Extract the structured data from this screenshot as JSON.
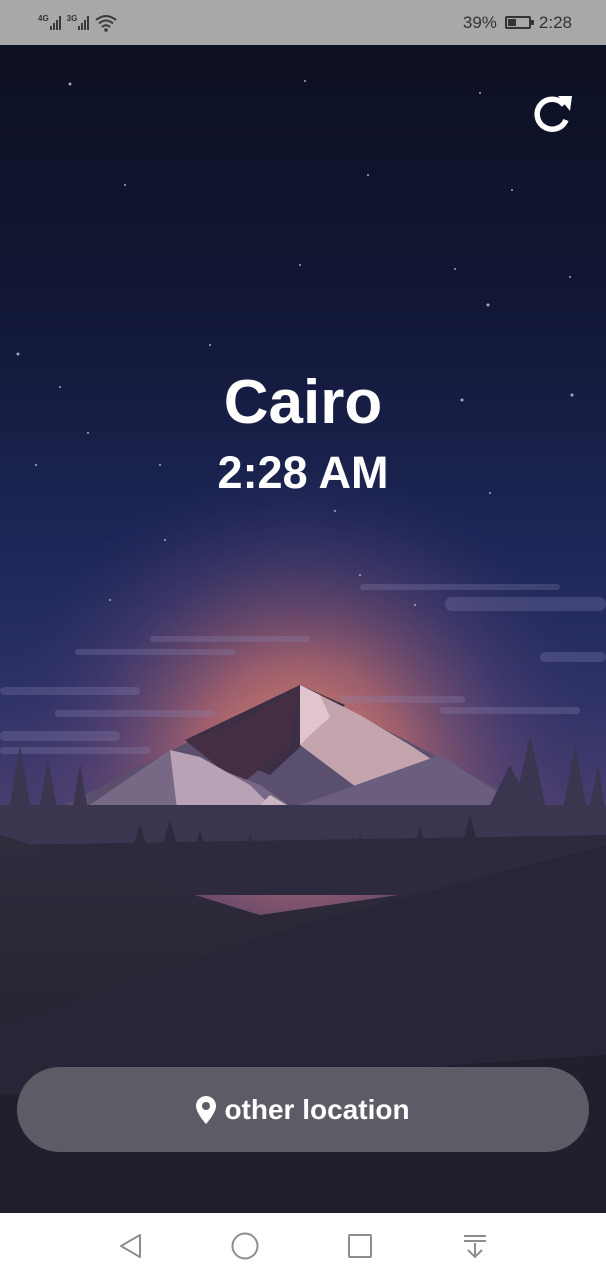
{
  "status_bar": {
    "network1": "4G",
    "network2": "3G",
    "battery_percent": "39%",
    "battery_level": 0.39,
    "time": "2:28"
  },
  "weather": {
    "city": "Cairo",
    "time": "2:28 AM"
  },
  "actions": {
    "other_location_label": "other location"
  },
  "icons": {
    "refresh": "refresh-icon",
    "location": "map-pin-icon",
    "back": "back-triangle-icon",
    "home": "home-circle-icon",
    "recents": "recents-square-icon",
    "notifications": "pull-down-icon"
  },
  "colors": {
    "sky_top": "#0e1124",
    "sky_mid": "#1f2a5c",
    "glow": "#d9806a",
    "button_bg": "#5c5c66",
    "ground": "#1c1b29"
  }
}
